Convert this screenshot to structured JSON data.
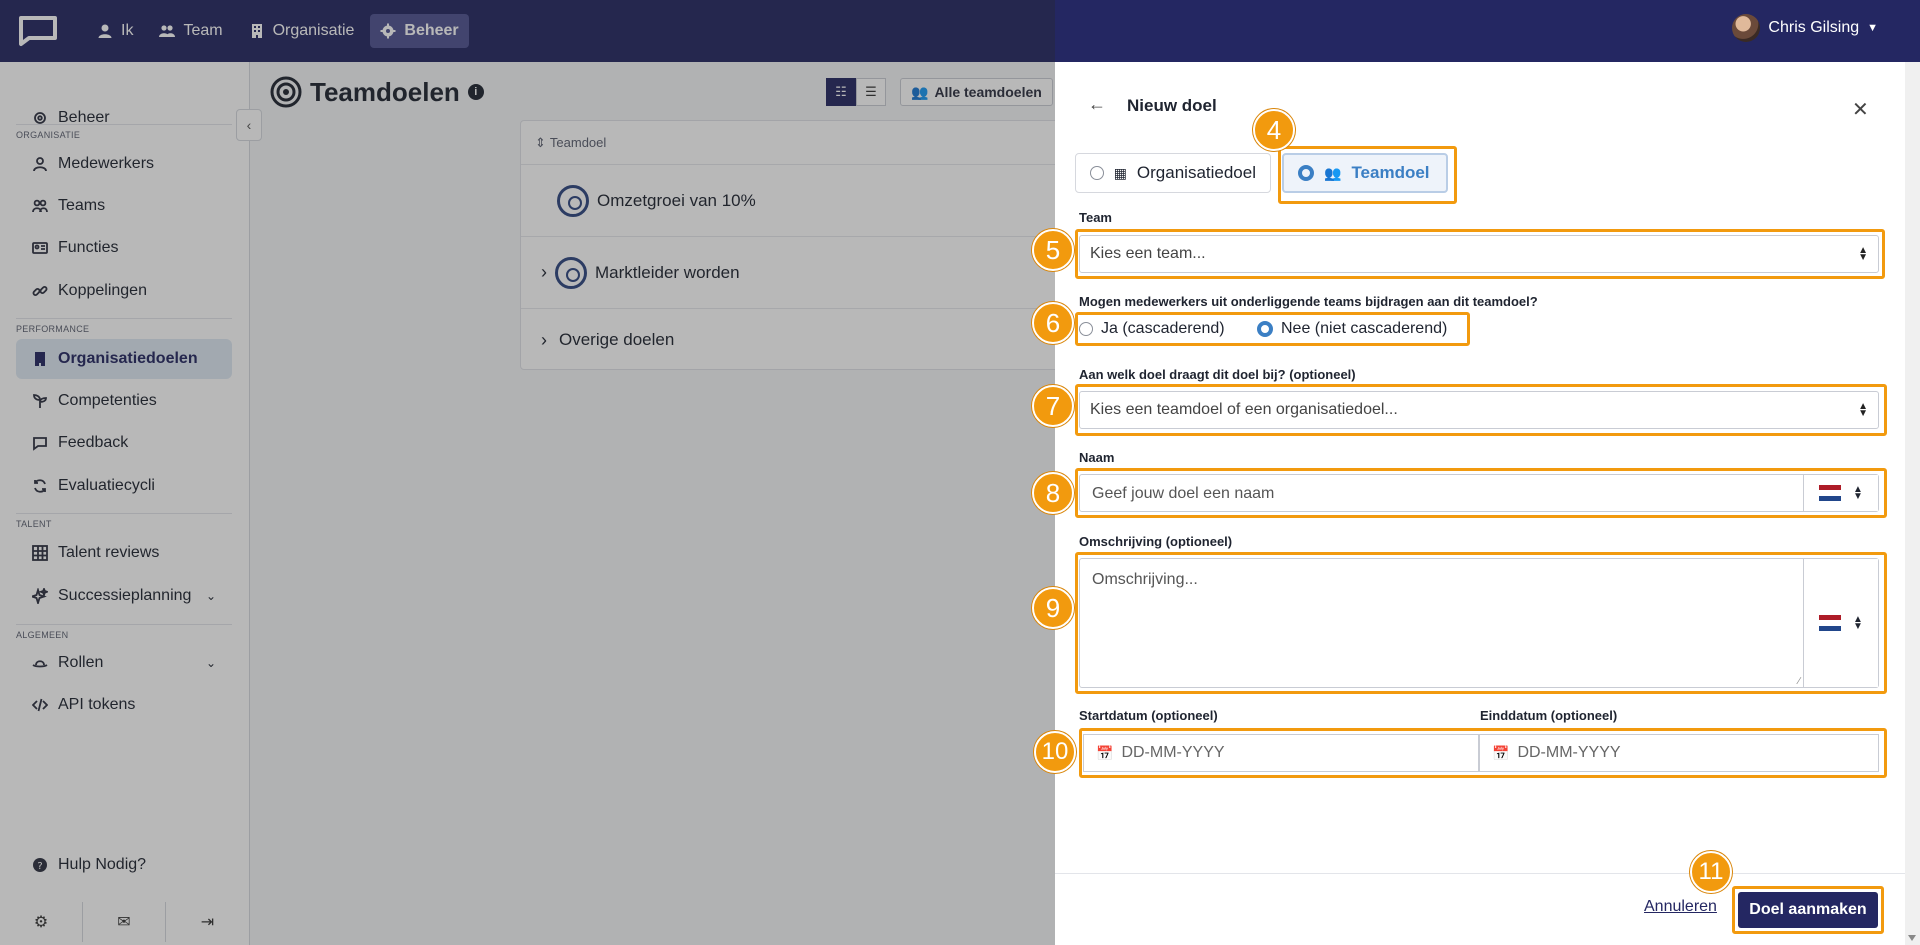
{
  "topbar": {
    "nav": [
      {
        "label": "Ik",
        "icon": "user-icon"
      },
      {
        "label": "Team",
        "icon": "users-icon"
      },
      {
        "label": "Organisatie",
        "icon": "building-icon"
      },
      {
        "label": "Beheer",
        "icon": "gear-icon",
        "active": true
      }
    ],
    "user_name": "Chris Gilsing"
  },
  "sidebar": {
    "top_item": "Beheer",
    "categories": {
      "organisatie": "ORGANISATIE",
      "performance": "PERFORMANCE",
      "talent": "TALENT",
      "algemeen": "ALGEMEEN"
    },
    "items": [
      {
        "label": "Medewerkers"
      },
      {
        "label": "Teams"
      },
      {
        "label": "Functies"
      },
      {
        "label": "Koppelingen"
      },
      {
        "label": "Organisatiedoelen",
        "active": true
      },
      {
        "label": "Competenties"
      },
      {
        "label": "Feedback"
      },
      {
        "label": "Evaluatiecycli"
      },
      {
        "label": "Talent reviews"
      },
      {
        "label": "Successieplanning"
      },
      {
        "label": "Rollen"
      },
      {
        "label": "API tokens"
      }
    ],
    "help": "Hulp Nodig?"
  },
  "main": {
    "title": "Teamdoelen",
    "filter_label": "Alle teamdoelen",
    "column_header": "Teamdoel",
    "goals": [
      "Omzetgroei van 10%",
      "Marktleider worden",
      "Overige doelen"
    ]
  },
  "panel": {
    "title": "Nieuw doel",
    "type_org": "Organisatiedoel",
    "type_team": "Teamdoel",
    "team_label": "Team",
    "team_placeholder": "Kies een team...",
    "cascade_question": "Mogen medewerkers uit onderliggende teams bijdragen aan dit teamdoel?",
    "cascade_yes": "Ja (cascaderend)",
    "cascade_no": "Nee (niet cascaderend)",
    "contributes_label": "Aan welk doel draagt dit doel bij? (optioneel)",
    "contributes_placeholder": "Kies een teamdoel of een organisatiedoel...",
    "name_label": "Naam",
    "name_placeholder": "Geef jouw doel een naam",
    "desc_label": "Omschrijving (optioneel)",
    "desc_placeholder": "Omschrijving...",
    "start_label": "Startdatum (optioneel)",
    "end_label": "Einddatum (optioneel)",
    "date_placeholder": "DD-MM-YYYY",
    "cancel": "Annuleren",
    "submit": "Doel aanmaken"
  },
  "callouts": [
    "4",
    "5",
    "6",
    "7",
    "8",
    "9",
    "10",
    "11"
  ],
  "colors": {
    "navy": "#242762",
    "highlight": "#f29a0e",
    "accent": "#3b7fc4"
  }
}
